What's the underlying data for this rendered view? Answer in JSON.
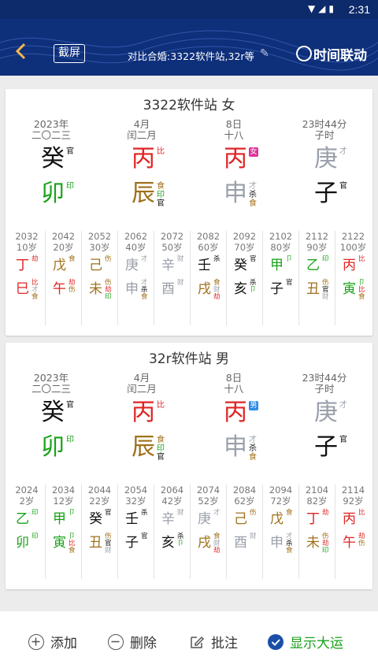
{
  "status": {
    "time": "2:31"
  },
  "header": {
    "screenshot": "截屏",
    "compare": "对比合婚:3322软件站,32r等",
    "sync": "时间联动"
  },
  "colors": {
    "red": "#e02424",
    "green": "#1aa21a",
    "brown": "#a0701b",
    "gray": "#9aa0aa",
    "black": "#111111",
    "female_badge": "#e0339a",
    "male_badge": "#2f8be6"
  },
  "cards": [
    {
      "title": "3322软件站 女",
      "pillars": [
        {
          "l1": "2023年",
          "l2": "二〇二三",
          "stem": "癸",
          "stem_color": "black",
          "stem_tag": "官",
          "branch": "卯",
          "branch_color": "green",
          "hidden": [
            {
              "t": "印",
              "c": "green"
            }
          ]
        },
        {
          "l1": "4月",
          "l2": "闰二月",
          "stem": "丙",
          "stem_color": "red",
          "stem_tag": "比",
          "branch": "辰",
          "branch_color": "brown",
          "hidden": [
            {
              "t": "食",
              "c": "brown"
            },
            {
              "t": "印",
              "c": "green"
            },
            {
              "t": "官",
              "c": "black"
            }
          ]
        },
        {
          "l1": "8日",
          "l2": "十八",
          "stem": "丙",
          "stem_color": "red",
          "badge": "女",
          "badge_color": "female_badge",
          "branch": "申",
          "branch_color": "gray",
          "hidden": [
            {
              "t": "才",
              "c": "gray"
            },
            {
              "t": "杀",
              "c": "black"
            },
            {
              "t": "食",
              "c": "brown"
            }
          ]
        },
        {
          "l1": "23时44分",
          "l2": "子时",
          "stem": "庚",
          "stem_color": "gray",
          "stem_tag": "才",
          "branch": "子",
          "branch_color": "black",
          "hidden": [
            {
              "t": "官",
              "c": "black"
            }
          ]
        }
      ],
      "dayun": [
        {
          "yr": "2032",
          "age": "10岁",
          "g": "丁",
          "gc": "red",
          "gs": [
            {
              "t": "劫",
              "c": "red"
            }
          ],
          "z": "巳",
          "zc": "red",
          "zs": [
            {
              "t": "比",
              "c": "red"
            },
            {
              "t": "才",
              "c": "gray"
            },
            {
              "t": "食",
              "c": "brown"
            }
          ]
        },
        {
          "yr": "2042",
          "age": "20岁",
          "g": "戊",
          "gc": "brown",
          "gs": [
            {
              "t": "食",
              "c": "brown"
            }
          ],
          "z": "午",
          "zc": "red",
          "zs": [
            {
              "t": "劫",
              "c": "red"
            },
            {
              "t": "伤",
              "c": "brown"
            }
          ]
        },
        {
          "yr": "2052",
          "age": "30岁",
          "g": "己",
          "gc": "brown",
          "gs": [
            {
              "t": "伤",
              "c": "brown"
            }
          ],
          "z": "未",
          "zc": "brown",
          "zs": [
            {
              "t": "伤",
              "c": "brown"
            },
            {
              "t": "劫",
              "c": "red"
            },
            {
              "t": "印",
              "c": "green"
            }
          ]
        },
        {
          "yr": "2062",
          "age": "40岁",
          "g": "庚",
          "gc": "gray",
          "gs": [
            {
              "t": "才",
              "c": "gray"
            }
          ],
          "z": "申",
          "zc": "gray",
          "zs": [
            {
              "t": "才",
              "c": "gray"
            },
            {
              "t": "杀",
              "c": "black"
            },
            {
              "t": "食",
              "c": "brown"
            }
          ]
        },
        {
          "yr": "2072",
          "age": "50岁",
          "g": "辛",
          "gc": "gray",
          "gs": [
            {
              "t": "财",
              "c": "gray"
            }
          ],
          "z": "酉",
          "zc": "gray",
          "zs": [
            {
              "t": "财",
              "c": "gray"
            }
          ]
        },
        {
          "yr": "2082",
          "age": "60岁",
          "g": "壬",
          "gc": "black",
          "gs": [
            {
              "t": "杀",
              "c": "black"
            }
          ],
          "z": "戌",
          "zc": "brown",
          "zs": [
            {
              "t": "食",
              "c": "brown"
            },
            {
              "t": "财",
              "c": "gray"
            },
            {
              "t": "劫",
              "c": "red"
            }
          ]
        },
        {
          "yr": "2092",
          "age": "70岁",
          "g": "癸",
          "gc": "black",
          "gs": [
            {
              "t": "官",
              "c": "black"
            }
          ],
          "z": "亥",
          "zc": "black",
          "zs": [
            {
              "t": "杀",
              "c": "black"
            },
            {
              "t": "卩",
              "c": "green"
            }
          ]
        },
        {
          "yr": "2102",
          "age": "80岁",
          "g": "甲",
          "gc": "green",
          "gs": [
            {
              "t": "卩",
              "c": "green"
            }
          ],
          "z": "子",
          "zc": "black",
          "zs": [
            {
              "t": "官",
              "c": "black"
            }
          ]
        },
        {
          "yr": "2112",
          "age": "90岁",
          "g": "乙",
          "gc": "green",
          "gs": [
            {
              "t": "印",
              "c": "green"
            }
          ],
          "z": "丑",
          "zc": "brown",
          "zs": [
            {
              "t": "伤",
              "c": "brown"
            },
            {
              "t": "官",
              "c": "black"
            },
            {
              "t": "财",
              "c": "gray"
            }
          ]
        },
        {
          "yr": "2122",
          "age": "100岁",
          "g": "丙",
          "gc": "red",
          "gs": [
            {
              "t": "比",
              "c": "red"
            }
          ],
          "z": "寅",
          "zc": "green",
          "zs": [
            {
              "t": "卩",
              "c": "green"
            },
            {
              "t": "比",
              "c": "red"
            },
            {
              "t": "食",
              "c": "brown"
            }
          ]
        }
      ]
    },
    {
      "title": "32r软件站 男",
      "pillars": [
        {
          "l1": "2023年",
          "l2": "二〇二三",
          "stem": "癸",
          "stem_color": "black",
          "stem_tag": "官",
          "branch": "卯",
          "branch_color": "green",
          "hidden": [
            {
              "t": "印",
              "c": "green"
            }
          ]
        },
        {
          "l1": "4月",
          "l2": "闰二月",
          "stem": "丙",
          "stem_color": "red",
          "stem_tag": "比",
          "branch": "辰",
          "branch_color": "brown",
          "hidden": [
            {
              "t": "食",
              "c": "brown"
            },
            {
              "t": "印",
              "c": "green"
            },
            {
              "t": "官",
              "c": "black"
            }
          ]
        },
        {
          "l1": "8日",
          "l2": "十八",
          "stem": "丙",
          "stem_color": "red",
          "badge": "男",
          "badge_color": "male_badge",
          "branch": "申",
          "branch_color": "gray",
          "hidden": [
            {
              "t": "才",
              "c": "gray"
            },
            {
              "t": "杀",
              "c": "black"
            },
            {
              "t": "食",
              "c": "brown"
            }
          ]
        },
        {
          "l1": "23时44分",
          "l2": "子时",
          "stem": "庚",
          "stem_color": "gray",
          "stem_tag": "才",
          "branch": "子",
          "branch_color": "black",
          "hidden": [
            {
              "t": "官",
              "c": "black"
            }
          ]
        }
      ],
      "dayun": [
        {
          "yr": "2024",
          "age": "2岁",
          "g": "乙",
          "gc": "green",
          "gs": [
            {
              "t": "印",
              "c": "green"
            }
          ],
          "z": "卯",
          "zc": "green",
          "zs": [
            {
              "t": "印",
              "c": "green"
            }
          ]
        },
        {
          "yr": "2034",
          "age": "12岁",
          "g": "甲",
          "gc": "green",
          "gs": [
            {
              "t": "卩",
              "c": "green"
            }
          ],
          "z": "寅",
          "zc": "green",
          "zs": [
            {
              "t": "卩",
              "c": "green"
            },
            {
              "t": "比",
              "c": "red"
            },
            {
              "t": "食",
              "c": "brown"
            }
          ]
        },
        {
          "yr": "2044",
          "age": "22岁",
          "g": "癸",
          "gc": "black",
          "gs": [
            {
              "t": "官",
              "c": "black"
            }
          ],
          "z": "丑",
          "zc": "brown",
          "zs": [
            {
              "t": "伤",
              "c": "brown"
            },
            {
              "t": "官",
              "c": "black"
            },
            {
              "t": "财",
              "c": "gray"
            }
          ]
        },
        {
          "yr": "2054",
          "age": "32岁",
          "g": "壬",
          "gc": "black",
          "gs": [
            {
              "t": "杀",
              "c": "black"
            }
          ],
          "z": "子",
          "zc": "black",
          "zs": [
            {
              "t": "官",
              "c": "black"
            }
          ]
        },
        {
          "yr": "2064",
          "age": "42岁",
          "g": "辛",
          "gc": "gray",
          "gs": [
            {
              "t": "财",
              "c": "gray"
            }
          ],
          "z": "亥",
          "zc": "black",
          "zs": [
            {
              "t": "杀",
              "c": "black"
            },
            {
              "t": "卩",
              "c": "green"
            }
          ]
        },
        {
          "yr": "2074",
          "age": "52岁",
          "g": "庚",
          "gc": "gray",
          "gs": [
            {
              "t": "才",
              "c": "gray"
            }
          ],
          "z": "戌",
          "zc": "brown",
          "zs": [
            {
              "t": "食",
              "c": "brown"
            },
            {
              "t": "财",
              "c": "gray"
            },
            {
              "t": "劫",
              "c": "red"
            }
          ]
        },
        {
          "yr": "2084",
          "age": "62岁",
          "g": "己",
          "gc": "brown",
          "gs": [
            {
              "t": "伤",
              "c": "brown"
            }
          ],
          "z": "酉",
          "zc": "gray",
          "zs": [
            {
              "t": "财",
              "c": "gray"
            }
          ]
        },
        {
          "yr": "2094",
          "age": "72岁",
          "g": "戊",
          "gc": "brown",
          "gs": [
            {
              "t": "食",
              "c": "brown"
            }
          ],
          "z": "申",
          "zc": "gray",
          "zs": [
            {
              "t": "才",
              "c": "gray"
            },
            {
              "t": "杀",
              "c": "black"
            },
            {
              "t": "食",
              "c": "brown"
            }
          ]
        },
        {
          "yr": "2104",
          "age": "82岁",
          "g": "丁",
          "gc": "red",
          "gs": [
            {
              "t": "劫",
              "c": "red"
            }
          ],
          "z": "未",
          "zc": "brown",
          "zs": [
            {
              "t": "伤",
              "c": "brown"
            },
            {
              "t": "劫",
              "c": "red"
            },
            {
              "t": "印",
              "c": "green"
            }
          ]
        },
        {
          "yr": "2114",
          "age": "92岁",
          "g": "丙",
          "gc": "red",
          "gs": [
            {
              "t": "比",
              "c": "red"
            }
          ],
          "z": "午",
          "zc": "red",
          "zs": [
            {
              "t": "劫",
              "c": "red"
            },
            {
              "t": "伤",
              "c": "brown"
            }
          ]
        }
      ]
    }
  ],
  "bottom": {
    "add": "添加",
    "delete": "删除",
    "note": "批注",
    "show_dayun": "显示大运"
  }
}
